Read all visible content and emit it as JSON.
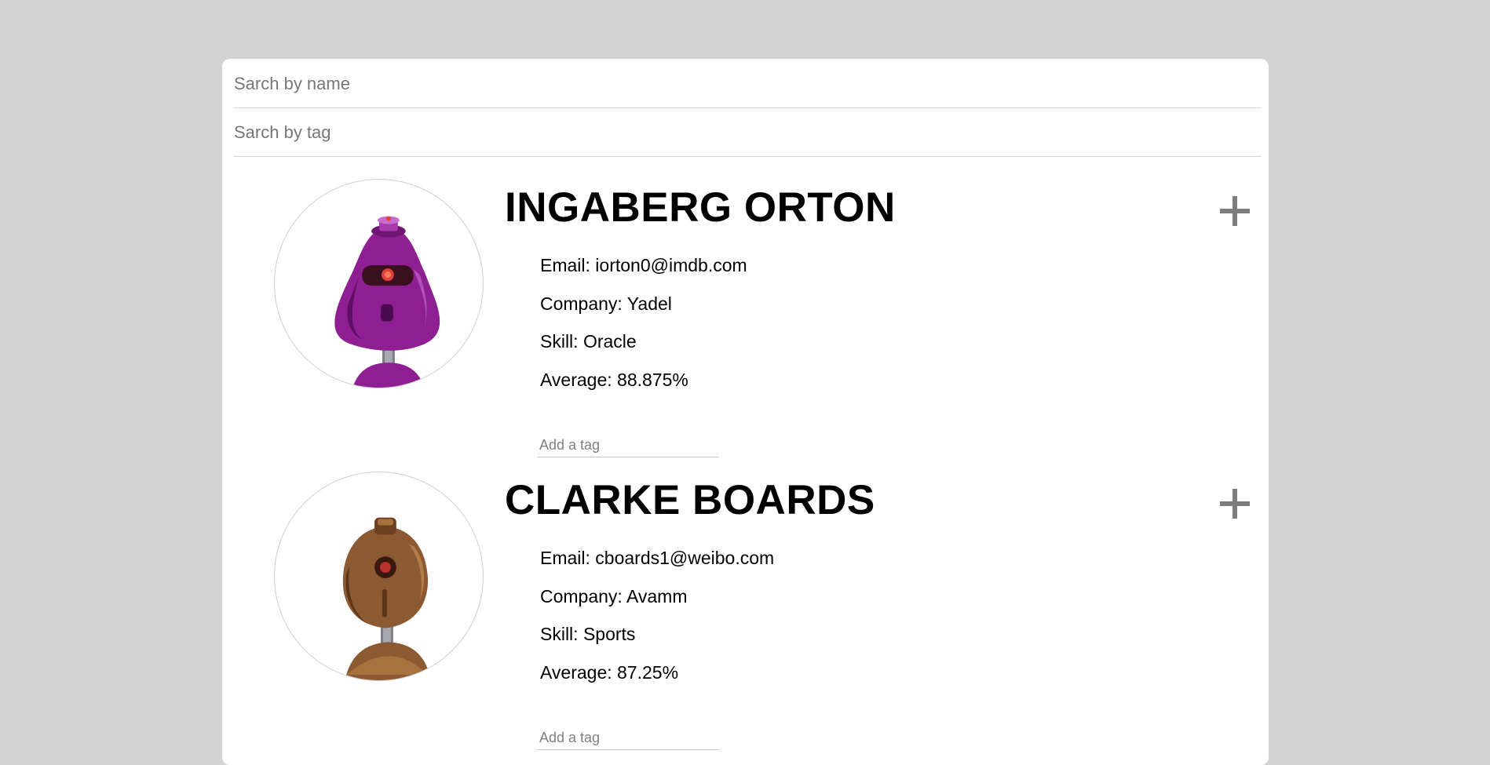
{
  "search": {
    "name_placeholder": "Sarch by name",
    "tag_placeholder": "Sarch by tag"
  },
  "students": [
    {
      "name": "INGABERG ORTON",
      "email_label": "Email: iorton0@imdb.com",
      "company_label": "Company: Yadel",
      "skill_label": "Skill: Oracle",
      "average_label": "Average: 88.875%",
      "tag_placeholder": "Add a tag",
      "avatar_icon": "purple-robot-icon",
      "avatar_color": "#8e1f93"
    },
    {
      "name": "CLARKE BOARDS",
      "email_label": "Email: cboards1@weibo.com",
      "company_label": "Company: Avamm",
      "skill_label": "Skill: Sports",
      "average_label": "Average: 87.25%",
      "tag_placeholder": "Add a tag",
      "avatar_icon": "brown-robot-icon",
      "avatar_color": "#8b5a32"
    }
  ],
  "colors": {
    "background": "#d3d3d3",
    "card": "#ffffff",
    "expand_icon": "#7d7d7d"
  }
}
